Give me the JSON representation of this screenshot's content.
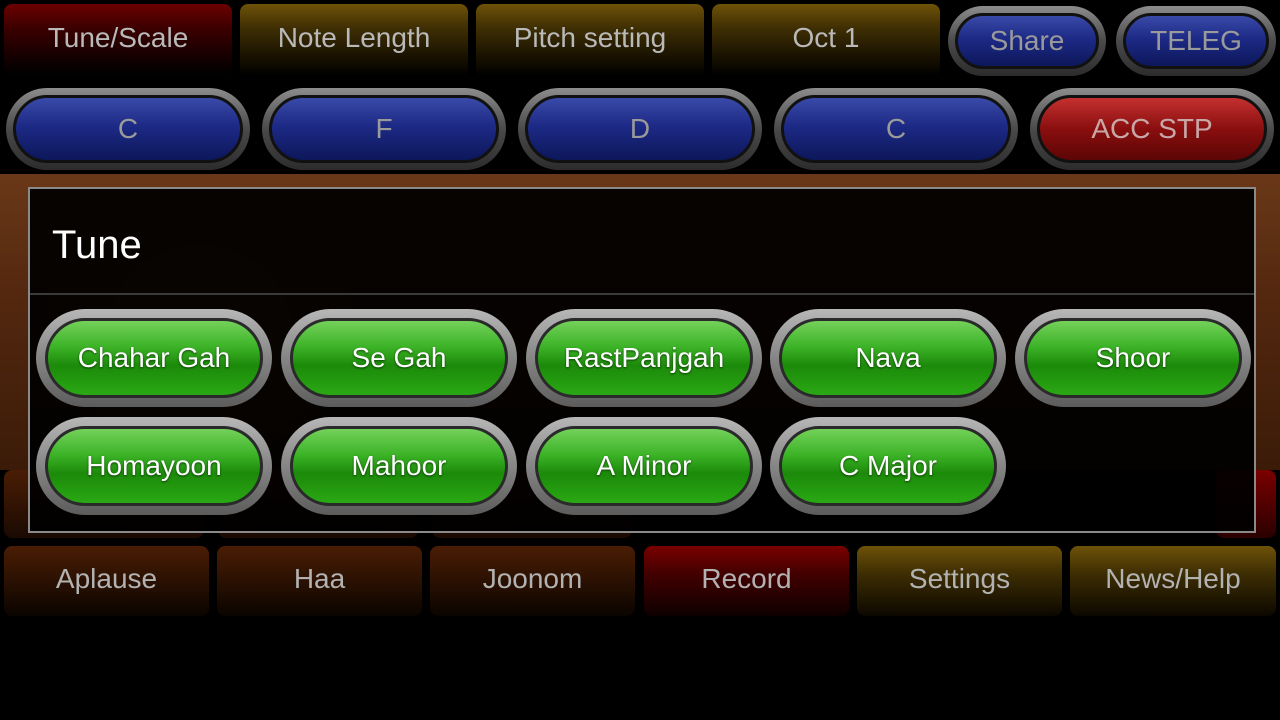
{
  "top_tabs": {
    "tune_scale": "Tune/Scale",
    "note_length": "Note Length",
    "pitch_setting": "Pitch setting",
    "octave": "Oct 1",
    "share": "Share",
    "teleg": "TELEG"
  },
  "key_row": {
    "key1": "C",
    "key2": "F",
    "key3": "D",
    "key4": "C",
    "acc_stop": "ACC STP"
  },
  "dialog": {
    "title": "Tune",
    "options": [
      "Chahar Gah",
      "Se Gah",
      "RastPanjgah",
      "Nava",
      "Shoor",
      "Homayoon",
      "Mahoor",
      "A Minor",
      "C Major"
    ]
  },
  "bottom_tabs": {
    "applause": "Aplause",
    "haa": "Haa",
    "joonom": "Joonom",
    "record": "Record",
    "settings": "Settings",
    "news_help": "News/Help"
  },
  "colors": {
    "red_tab": "#6c0000",
    "gold_tab": "#6e5208",
    "blue_pill": "#1d2a86",
    "green_option": "#3cb327",
    "brown_tab": "#4a1d04"
  }
}
